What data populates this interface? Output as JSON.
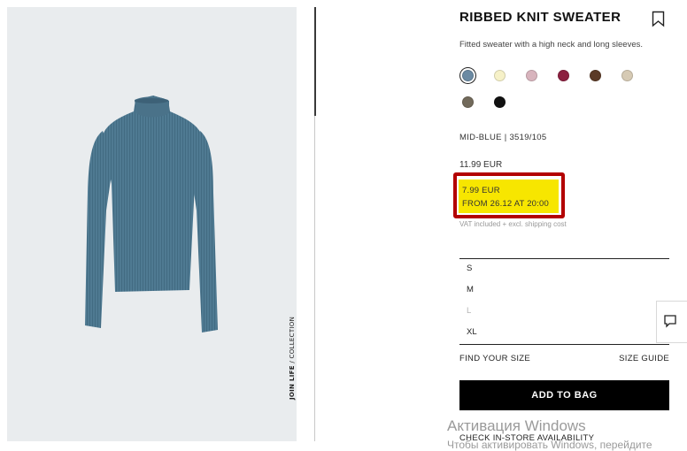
{
  "product": {
    "name": "RIBBED KNIT SWEATER",
    "description": "Fitted sweater with a high neck and long sleeves.",
    "color_ref": "MID-BLUE | 3519/105",
    "original_price": "11.99 EUR",
    "sale_price": "7.99 EUR",
    "sale_note": "FROM 26.12 AT 20:00",
    "vat_note": "VAT included + excl. shipping cost"
  },
  "side_label": {
    "bold": "JOIN LIFE",
    "rest": " / COLLECTION"
  },
  "colors": [
    {
      "hex": "#6b8aa3",
      "selected": true
    },
    {
      "hex": "#f6f1c8"
    },
    {
      "hex": "#d8b4bd"
    },
    {
      "hex": "#8c2040"
    },
    {
      "hex": "#5b3a26"
    },
    {
      "hex": "#d6cab4"
    },
    {
      "hex": "#726a5b"
    },
    {
      "hex": "#111111"
    }
  ],
  "sizes": [
    {
      "label": "S",
      "available": true
    },
    {
      "label": "M",
      "available": true
    },
    {
      "label": "L",
      "available": false
    },
    {
      "label": "XL",
      "available": true
    }
  ],
  "actions": {
    "find_size": "FIND YOUR SIZE",
    "size_guide": "SIZE GUIDE",
    "add_to_bag": "ADD TO BAG",
    "store_availability": "CHECK IN-STORE AVAILABILITY"
  },
  "overlay": {
    "line1": "Активация Windows",
    "line2": "Чтобы активировать Windows, перейдите"
  },
  "icons": {
    "bookmark": "bookmark-icon",
    "chat": "chat-icon"
  }
}
